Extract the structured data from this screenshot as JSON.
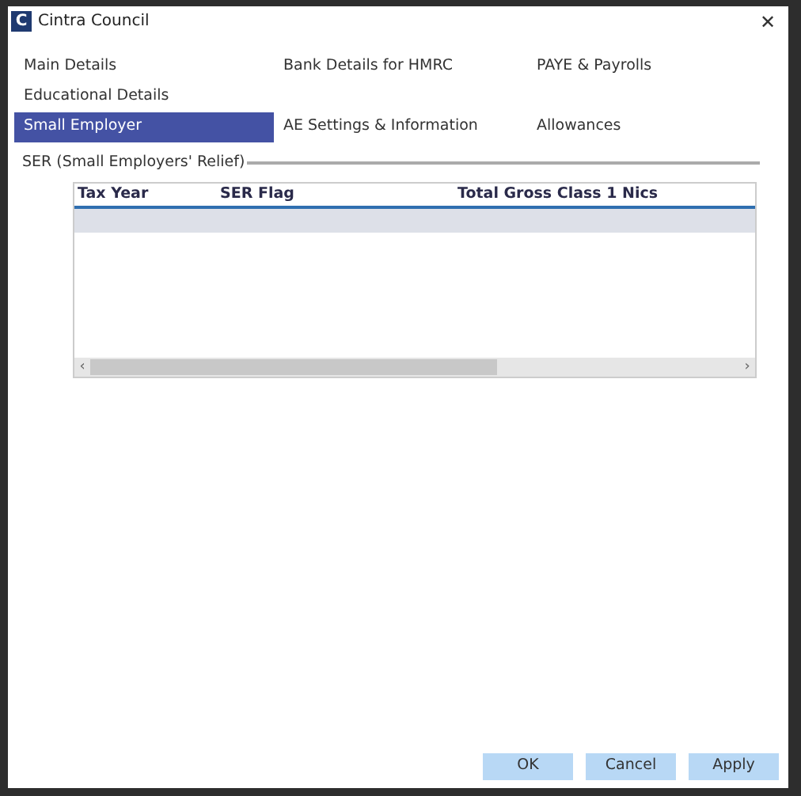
{
  "window": {
    "title": "Cintra Council",
    "logo": "C",
    "close": "✕"
  },
  "tab_rows": [
    [
      {
        "label": "Main Details",
        "selected": false
      },
      {
        "label": "Bank Details for HMRC",
        "selected": false
      },
      {
        "label": "PAYE & Payrolls",
        "selected": false
      }
    ],
    [
      {
        "label": "Educational Details",
        "selected": false
      }
    ],
    [
      {
        "label": "Small Employer",
        "selected": true
      },
      {
        "label": "AE Settings & Information",
        "selected": false
      },
      {
        "label": "Allowances",
        "selected": false
      }
    ]
  ],
  "group": {
    "title": "SER (Small Employers' Relief)"
  },
  "table": {
    "columns": [
      "Tax Year",
      "SER Flag",
      "Total Gross Class 1 Nics"
    ],
    "rows": [
      {
        "selected": true
      }
    ],
    "scroll_left": "‹",
    "scroll_right": "›"
  },
  "buttons": [
    "OK",
    "Cancel",
    "Apply"
  ]
}
